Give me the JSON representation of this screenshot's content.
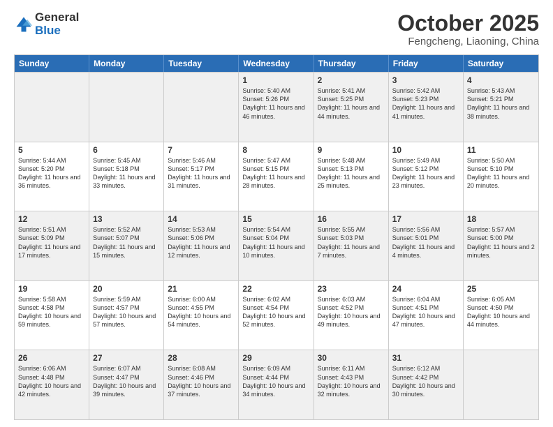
{
  "logo": {
    "general": "General",
    "blue": "Blue"
  },
  "title": "October 2025",
  "location": "Fengcheng, Liaoning, China",
  "days_of_week": [
    "Sunday",
    "Monday",
    "Tuesday",
    "Wednesday",
    "Thursday",
    "Friday",
    "Saturday"
  ],
  "weeks": [
    [
      {
        "day": "",
        "text": ""
      },
      {
        "day": "",
        "text": ""
      },
      {
        "day": "",
        "text": ""
      },
      {
        "day": "1",
        "text": "Sunrise: 5:40 AM\nSunset: 5:26 PM\nDaylight: 11 hours and 46 minutes."
      },
      {
        "day": "2",
        "text": "Sunrise: 5:41 AM\nSunset: 5:25 PM\nDaylight: 11 hours and 44 minutes."
      },
      {
        "day": "3",
        "text": "Sunrise: 5:42 AM\nSunset: 5:23 PM\nDaylight: 11 hours and 41 minutes."
      },
      {
        "day": "4",
        "text": "Sunrise: 5:43 AM\nSunset: 5:21 PM\nDaylight: 11 hours and 38 minutes."
      }
    ],
    [
      {
        "day": "5",
        "text": "Sunrise: 5:44 AM\nSunset: 5:20 PM\nDaylight: 11 hours and 36 minutes."
      },
      {
        "day": "6",
        "text": "Sunrise: 5:45 AM\nSunset: 5:18 PM\nDaylight: 11 hours and 33 minutes."
      },
      {
        "day": "7",
        "text": "Sunrise: 5:46 AM\nSunset: 5:17 PM\nDaylight: 11 hours and 31 minutes."
      },
      {
        "day": "8",
        "text": "Sunrise: 5:47 AM\nSunset: 5:15 PM\nDaylight: 11 hours and 28 minutes."
      },
      {
        "day": "9",
        "text": "Sunrise: 5:48 AM\nSunset: 5:13 PM\nDaylight: 11 hours and 25 minutes."
      },
      {
        "day": "10",
        "text": "Sunrise: 5:49 AM\nSunset: 5:12 PM\nDaylight: 11 hours and 23 minutes."
      },
      {
        "day": "11",
        "text": "Sunrise: 5:50 AM\nSunset: 5:10 PM\nDaylight: 11 hours and 20 minutes."
      }
    ],
    [
      {
        "day": "12",
        "text": "Sunrise: 5:51 AM\nSunset: 5:09 PM\nDaylight: 11 hours and 17 minutes."
      },
      {
        "day": "13",
        "text": "Sunrise: 5:52 AM\nSunset: 5:07 PM\nDaylight: 11 hours and 15 minutes."
      },
      {
        "day": "14",
        "text": "Sunrise: 5:53 AM\nSunset: 5:06 PM\nDaylight: 11 hours and 12 minutes."
      },
      {
        "day": "15",
        "text": "Sunrise: 5:54 AM\nSunset: 5:04 PM\nDaylight: 11 hours and 10 minutes."
      },
      {
        "day": "16",
        "text": "Sunrise: 5:55 AM\nSunset: 5:03 PM\nDaylight: 11 hours and 7 minutes."
      },
      {
        "day": "17",
        "text": "Sunrise: 5:56 AM\nSunset: 5:01 PM\nDaylight: 11 hours and 4 minutes."
      },
      {
        "day": "18",
        "text": "Sunrise: 5:57 AM\nSunset: 5:00 PM\nDaylight: 11 hours and 2 minutes."
      }
    ],
    [
      {
        "day": "19",
        "text": "Sunrise: 5:58 AM\nSunset: 4:58 PM\nDaylight: 10 hours and 59 minutes."
      },
      {
        "day": "20",
        "text": "Sunrise: 5:59 AM\nSunset: 4:57 PM\nDaylight: 10 hours and 57 minutes."
      },
      {
        "day": "21",
        "text": "Sunrise: 6:00 AM\nSunset: 4:55 PM\nDaylight: 10 hours and 54 minutes."
      },
      {
        "day": "22",
        "text": "Sunrise: 6:02 AM\nSunset: 4:54 PM\nDaylight: 10 hours and 52 minutes."
      },
      {
        "day": "23",
        "text": "Sunrise: 6:03 AM\nSunset: 4:52 PM\nDaylight: 10 hours and 49 minutes."
      },
      {
        "day": "24",
        "text": "Sunrise: 6:04 AM\nSunset: 4:51 PM\nDaylight: 10 hours and 47 minutes."
      },
      {
        "day": "25",
        "text": "Sunrise: 6:05 AM\nSunset: 4:50 PM\nDaylight: 10 hours and 44 minutes."
      }
    ],
    [
      {
        "day": "26",
        "text": "Sunrise: 6:06 AM\nSunset: 4:48 PM\nDaylight: 10 hours and 42 minutes."
      },
      {
        "day": "27",
        "text": "Sunrise: 6:07 AM\nSunset: 4:47 PM\nDaylight: 10 hours and 39 minutes."
      },
      {
        "day": "28",
        "text": "Sunrise: 6:08 AM\nSunset: 4:46 PM\nDaylight: 10 hours and 37 minutes."
      },
      {
        "day": "29",
        "text": "Sunrise: 6:09 AM\nSunset: 4:44 PM\nDaylight: 10 hours and 34 minutes."
      },
      {
        "day": "30",
        "text": "Sunrise: 6:11 AM\nSunset: 4:43 PM\nDaylight: 10 hours and 32 minutes."
      },
      {
        "day": "31",
        "text": "Sunrise: 6:12 AM\nSunset: 4:42 PM\nDaylight: 10 hours and 30 minutes."
      },
      {
        "day": "",
        "text": ""
      }
    ]
  ],
  "shaded_rows": [
    0,
    2,
    4
  ],
  "colors": {
    "header_bg": "#2a6db5",
    "shaded_cell": "#f0f0f0",
    "white_cell": "#ffffff"
  }
}
